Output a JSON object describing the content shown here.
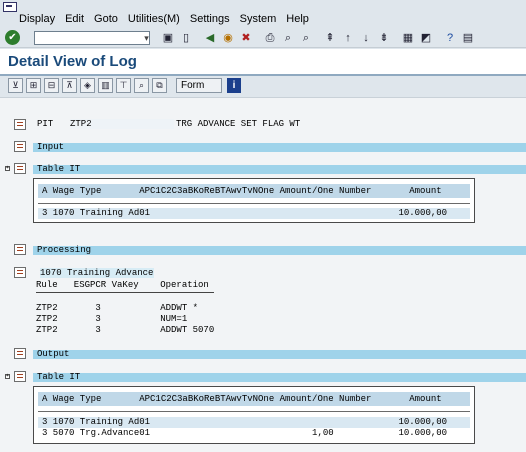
{
  "menu": [
    "Display",
    "Edit",
    "Goto",
    "Utilities(M)",
    "Settings",
    "System",
    "Help"
  ],
  "toolbar": {
    "ok_icon": "enter-icon",
    "command_value": ""
  },
  "page_title": "Detail View of Log",
  "app_toolbar": {
    "form_label": "Form",
    "info_icon": "i"
  },
  "log": {
    "pit_label": "PIT",
    "pit_value": "ZTP2",
    "pit_text": "TRG ADVANCE SET FLAG WT",
    "input_label": "Input",
    "table1_label": "Table IT",
    "table1_header": "A Wage Type       APC1C2C3aBKoReBTAwvTvNOne Amount/One Number       Amount",
    "table1_rows": [
      "3 1070 Training Ad01                                              10.000,00"
    ],
    "processing_label": "Processing",
    "processing_item": "1070 Training Advance",
    "rule_header": "Rule   ESGPCR VaKey    Operation",
    "rules": [
      "ZTP2       3           ADDWT *",
      "ZTP2       3           NUM=1",
      "ZTP2       3           ADDWT 5070"
    ],
    "output_label": "Output",
    "table2_label": "Table IT",
    "table2_header": "A Wage Type       APC1C2C3aBKoReBTAwvTvNOne Amount/One Number       Amount",
    "table2_rows": [
      "3 1070 Training Ad01                                              10.000,00",
      "3 5070 Trg.Advance01                              1,00            10.000,00"
    ]
  }
}
